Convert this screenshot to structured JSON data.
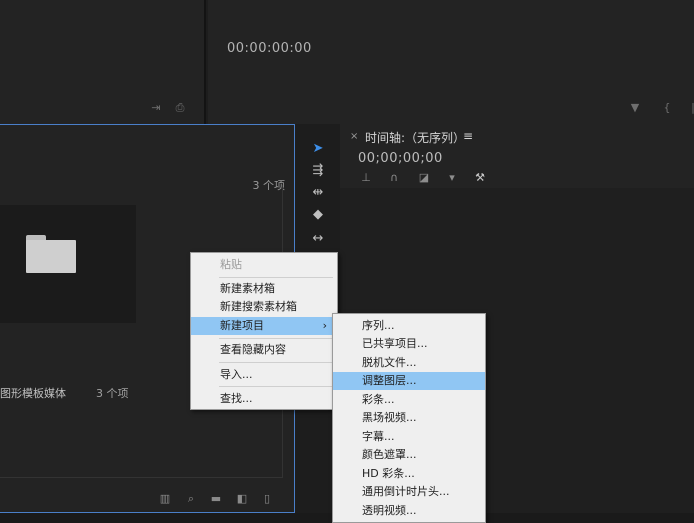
{
  "program_monitor": {
    "timecode": "00:00:00:00",
    "controls": [
      "marker-icon",
      "brace-left-icon",
      "pipe-icon"
    ]
  },
  "source_monitor": {
    "controls": [
      "insert-icon",
      "export-frame-icon"
    ]
  },
  "project_panel": {
    "item_count": "3 个项",
    "bin": {
      "name": "图形模板媒体",
      "count": "3 个项"
    },
    "bottom_icons": [
      "freeform-view-icon",
      "search-icon",
      "new-bin-icon",
      "new-item-icon",
      "trash-icon"
    ]
  },
  "tools": [
    "selection-tool-icon",
    "track-select-tool-icon",
    "ripple-edit-tool-icon",
    "razor-tool-icon",
    "slip-tool-icon"
  ],
  "timeline": {
    "title": "时间轴:（无序列）",
    "menu_glyph": "≡",
    "close_glyph": "×",
    "timecode": "00;00;00;00",
    "tool_icons": [
      "snap-icon",
      "link-icon",
      "marker-add-icon",
      "marker-icon",
      "wrench-icon"
    ]
  },
  "context_menu": {
    "items": [
      {
        "label": "粘贴",
        "disabled": true
      },
      {
        "label": "新建素材箱"
      },
      {
        "label": "新建搜索素材箱"
      },
      {
        "label": "新建项目",
        "highlighted": true,
        "has_submenu": true
      },
      {
        "label": "查看隐藏内容"
      },
      {
        "label": "导入..."
      },
      {
        "label": "查找..."
      }
    ],
    "submenu_arrow": "›"
  },
  "submenu": {
    "items": [
      {
        "label": "序列..."
      },
      {
        "label": "已共享项目..."
      },
      {
        "label": "脱机文件..."
      },
      {
        "label": "调整图层...",
        "highlighted": true
      },
      {
        "label": "彩条..."
      },
      {
        "label": "黑场视频..."
      },
      {
        "label": "字幕..."
      },
      {
        "label": "颜色遮罩..."
      },
      {
        "label": "HD 彩条..."
      },
      {
        "label": "通用倒计时片头..."
      },
      {
        "label": "透明视频..."
      }
    ]
  },
  "colors": {
    "highlight": "#90c6f3",
    "panel_focus_border": "#4a7fc9",
    "selection_tool": "#3d8ee8",
    "menu_bg": "#efefef"
  }
}
